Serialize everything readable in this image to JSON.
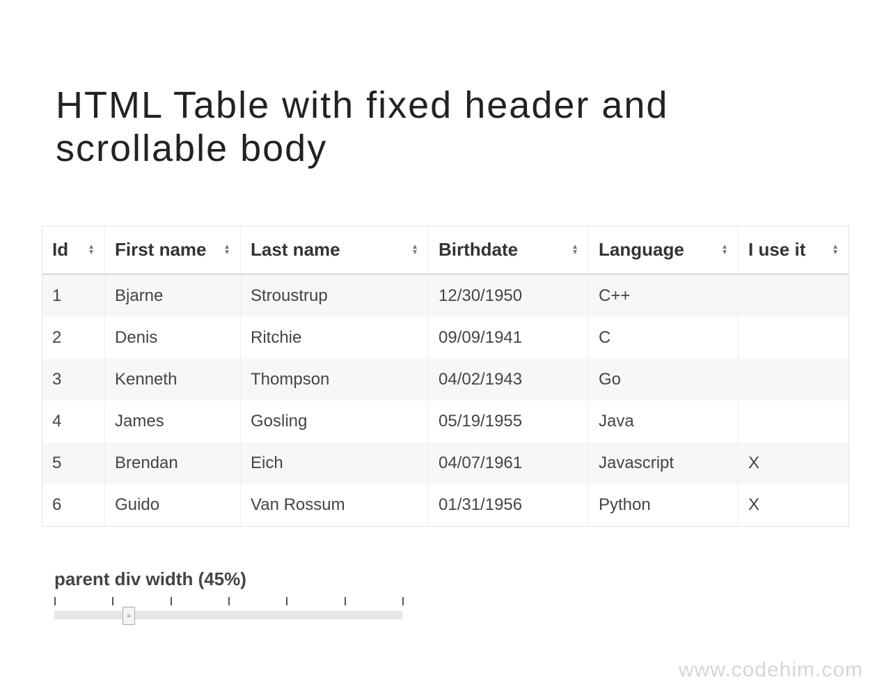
{
  "title": "HTML Table with fixed header and scrollable body",
  "table": {
    "headers": {
      "id": "Id",
      "first_name": "First name",
      "last_name": "Last name",
      "birthdate": "Birthdate",
      "language": "Language",
      "use_it": "I use it"
    },
    "rows": [
      {
        "id": "1",
        "first_name": "Bjarne",
        "last_name": "Stroustrup",
        "birthdate": "12/30/1950",
        "language": "C++",
        "use_it": ""
      },
      {
        "id": "2",
        "first_name": "Denis",
        "last_name": "Ritchie",
        "birthdate": "09/09/1941",
        "language": "C",
        "use_it": ""
      },
      {
        "id": "3",
        "first_name": "Kenneth",
        "last_name": "Thompson",
        "birthdate": "04/02/1943",
        "language": "Go",
        "use_it": ""
      },
      {
        "id": "4",
        "first_name": "James",
        "last_name": "Gosling",
        "birthdate": "05/19/1955",
        "language": "Java",
        "use_it": ""
      },
      {
        "id": "5",
        "first_name": "Brendan",
        "last_name": "Eich",
        "birthdate": "04/07/1961",
        "language": "Javascript",
        "use_it": "X"
      },
      {
        "id": "6",
        "first_name": "Guido",
        "last_name": "Van Rossum",
        "birthdate": "01/31/1956",
        "language": "Python",
        "use_it": "X"
      }
    ]
  },
  "slider": {
    "label": "parent div width (45%)",
    "value_percent": 45,
    "min": 30,
    "max": 100,
    "ticks": 7
  },
  "watermark": "www.codehim.com"
}
